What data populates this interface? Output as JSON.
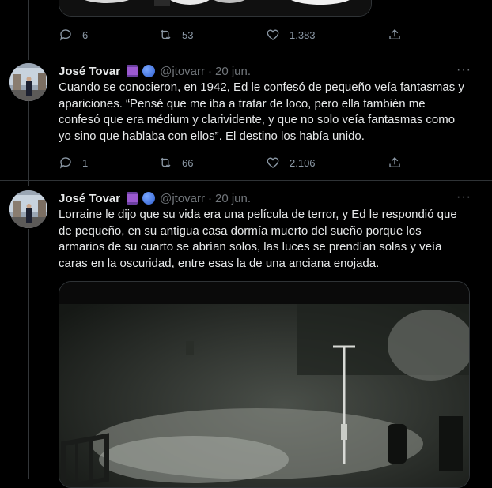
{
  "top_tweet": {
    "reply_count": "6",
    "retweet_count": "53",
    "like_count": "1.383"
  },
  "tweet1": {
    "name": "José Tovar",
    "handle": "@jtovarr",
    "separator": "·",
    "date": "20 jun.",
    "more": "···",
    "text": "Cuando se conocieron, en 1942, Ed le confesó de pequeño veía fantasmas y apariciones. “Pensé que me iba a tratar de loco, pero ella también me confesó que era médium y clarividente, y que no solo veía fantasmas como yo sino que hablaba con ellos”. El destino los había unido.",
    "reply_count": "1",
    "retweet_count": "66",
    "like_count": "2.106"
  },
  "tweet2": {
    "name": "José Tovar",
    "handle": "@jtovarr",
    "separator": "·",
    "date": "20 jun.",
    "more": "···",
    "text": "Lorraine le dijo que su vida era una película de terror, y Ed le respondió que de pequeño, en su antigua casa dormía muerto del sueño porque los armarios de su cuarto se abrían solos, las luces se prendían solas y veía caras en la oscuridad, entre esas la de una anciana enojada."
  },
  "icons": {
    "reply": "reply-icon",
    "retweet": "retweet-icon",
    "like": "heart-icon",
    "share": "share-icon",
    "thread_emoji": "thread-spool-emoji",
    "yarn_emoji": "yarn-ball-emoji"
  },
  "colors": {
    "background": "#000000",
    "text": "#e7e9ea",
    "muted": "#71767b",
    "divider": "#2f3336"
  }
}
